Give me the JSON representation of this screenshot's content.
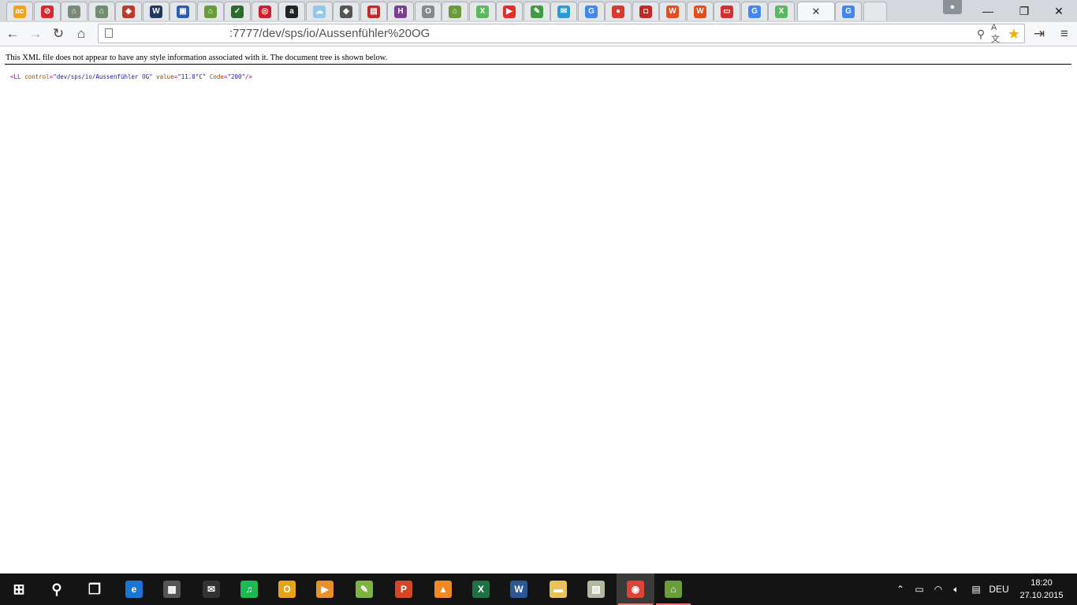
{
  "browser": {
    "url": ":7777/dev/sps/io/Aussenfühler%20OG",
    "tabs": [
      {
        "icon": "ac-favicon",
        "color": "#f4a21a",
        "glyph": "ac"
      },
      {
        "icon": "red-circle-favicon",
        "color": "#d9262f",
        "glyph": "⊘"
      },
      {
        "icon": "home-favicon",
        "color": "#7a8a7a",
        "glyph": "⌂"
      },
      {
        "icon": "home-favicon",
        "color": "#6f8f6f",
        "glyph": "⌂"
      },
      {
        "icon": "badge-favicon",
        "color": "#c0392b",
        "glyph": "◆"
      },
      {
        "icon": "wk-favicon",
        "color": "#1f3a5f",
        "glyph": "W"
      },
      {
        "icon": "shopping-bag-favicon",
        "color": "#2a5db0",
        "glyph": "▣"
      },
      {
        "icon": "house-arrow-favicon",
        "color": "#6a9c3a",
        "glyph": "⌂"
      },
      {
        "icon": "checkmark-favicon",
        "color": "#2d6a2d",
        "glyph": "✓"
      },
      {
        "icon": "target-favicon",
        "color": "#d0202e",
        "glyph": "◎"
      },
      {
        "icon": "amazon-favicon",
        "color": "#222222",
        "glyph": "a"
      },
      {
        "icon": "weather-favicon",
        "color": "#8fc8e8",
        "glyph": "☁"
      },
      {
        "icon": "diamond-favicon",
        "color": "#555555",
        "glyph": "◆"
      },
      {
        "icon": "document-favicon",
        "color": "#c62828",
        "glyph": "▤"
      },
      {
        "icon": "h-favicon",
        "color": "#7b3f93",
        "glyph": "H"
      },
      {
        "icon": "og-favicon",
        "color": "#888888",
        "glyph": "O"
      },
      {
        "icon": "house-arrow-favicon",
        "color": "#6a9c3a",
        "glyph": "⌂"
      },
      {
        "icon": "x-favicon",
        "color": "#5cb85c",
        "glyph": "X"
      },
      {
        "icon": "youtube-favicon",
        "color": "#e52d27",
        "glyph": "▶"
      },
      {
        "icon": "pen-favicon",
        "color": "#3f9b3f",
        "glyph": "✎"
      },
      {
        "icon": "chat-favicon",
        "color": "#2b9bd6",
        "glyph": "✉"
      },
      {
        "icon": "google-favicon",
        "color": "#4285f4",
        "glyph": "G"
      },
      {
        "icon": "tomato-favicon",
        "color": "#d63a2f",
        "glyph": "●"
      },
      {
        "icon": "red-square-favicon",
        "color": "#c62828",
        "glyph": "◘"
      },
      {
        "icon": "w-favicon",
        "color": "#e84b1c",
        "glyph": "W"
      },
      {
        "icon": "w-favicon",
        "color": "#e84b1c",
        "glyph": "W"
      },
      {
        "icon": "red-label-favicon",
        "color": "#d32f2f",
        "glyph": "▭"
      },
      {
        "icon": "google-favicon",
        "color": "#4285f4",
        "glyph": "G"
      },
      {
        "icon": "x-favicon",
        "color": "#5cb85c",
        "glyph": "X"
      }
    ],
    "active_tab": {
      "close_glyph": "✕"
    },
    "after_active_tab": {
      "icon": "google-favicon",
      "color": "#4285f4",
      "glyph": "G"
    }
  },
  "page": {
    "notice": "This XML file does not appear to have any style information associated with it. The document tree is shown below.",
    "xml": {
      "open": "<LL",
      "attr1_name": "control",
      "attr1_value": "\"dev/sps/io/Aussenfühler OG\"",
      "attr2_name": "value",
      "attr2_value": "\"11.0°C\"",
      "attr3_name": "Code",
      "attr3_value": "\"200\"",
      "close": "/>"
    }
  },
  "taskbar": {
    "apps": [
      {
        "name": "start-button",
        "glyph": "⊞",
        "color": "transparent"
      },
      {
        "name": "search-button",
        "glyph": "⚲",
        "color": "transparent"
      },
      {
        "name": "task-view-button",
        "glyph": "❐",
        "color": "transparent"
      },
      {
        "name": "edge-icon",
        "glyph": "e",
        "color": "#1976d2"
      },
      {
        "name": "store-icon",
        "glyph": "▦",
        "color": "#555"
      },
      {
        "name": "mail-icon",
        "glyph": "✉",
        "color": "#333"
      },
      {
        "name": "spotify-icon",
        "glyph": "♫",
        "color": "#1db954"
      },
      {
        "name": "outlook-icon",
        "glyph": "O",
        "color": "#e8a317"
      },
      {
        "name": "media-player-icon",
        "glyph": "▶",
        "color": "#e8912a"
      },
      {
        "name": "utility-icon",
        "glyph": "✎",
        "color": "#7cb342"
      },
      {
        "name": "powerpoint-icon",
        "glyph": "P",
        "color": "#d24726"
      },
      {
        "name": "vlc-icon",
        "glyph": "▲",
        "color": "#f08a24"
      },
      {
        "name": "excel-icon",
        "glyph": "X",
        "color": "#1e7145"
      },
      {
        "name": "word-icon",
        "glyph": "W",
        "color": "#2b5797"
      },
      {
        "name": "file-explorer-icon",
        "glyph": "▬",
        "color": "#e8c25a"
      },
      {
        "name": "gallery-icon",
        "glyph": "▧",
        "color": "#b0b8a0"
      },
      {
        "name": "chrome-icon",
        "glyph": "◉",
        "color": "#db4437"
      },
      {
        "name": "home-app-icon",
        "glyph": "⌂",
        "color": "#6a9c3a"
      }
    ],
    "language": "DEU",
    "time": "18:20",
    "date": "27.10.2015"
  }
}
